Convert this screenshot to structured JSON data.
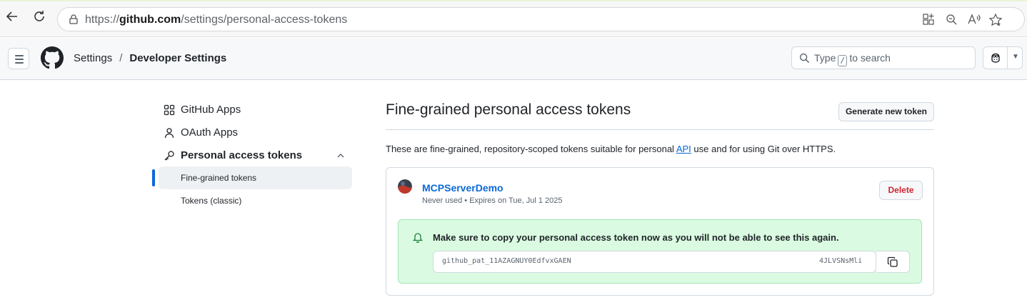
{
  "browser": {
    "url_scheme": "https://",
    "url_host": "github.com",
    "url_path": "/settings/personal-access-tokens",
    "icons": [
      "back-arrow-icon",
      "reload-icon",
      "site-info-icon",
      "app-available-icon",
      "zoom-icon",
      "read-aloud-icon",
      "favorite-star-icon"
    ]
  },
  "header": {
    "breadcrumb": {
      "settings": "Settings",
      "separator": "/",
      "current": "Developer Settings"
    },
    "search": {
      "prefix": "Type",
      "key": "/",
      "suffix": "to search"
    }
  },
  "sidebar": {
    "items": [
      {
        "label": "GitHub Apps",
        "icon": "apps-grid-icon"
      },
      {
        "label": "OAuth Apps",
        "icon": "person-icon"
      },
      {
        "label": "Personal access tokens",
        "icon": "key-icon",
        "expanded": true
      }
    ],
    "subitems": [
      {
        "label": "Fine-grained tokens",
        "active": true
      },
      {
        "label": "Tokens (classic)",
        "active": false
      }
    ]
  },
  "main": {
    "title": "Fine-grained personal access tokens",
    "generate_button": "Generate new token",
    "intro_before": "These are fine-grained, repository-scoped tokens suitable for personal ",
    "intro_link": "API",
    "intro_after": " use and for using Git over HTTPS.",
    "token": {
      "name": "MCPServerDemo",
      "meta": "Never used • Expires on Tue, Jul 1 2025",
      "delete_button": "Delete",
      "flash_message": "Make sure to copy your personal access token now as you will not be able to see this again.",
      "value_start": "github_pat_11AZAGNUY0EdfvxGAEN",
      "value_end": "4JLVSNsMli"
    }
  },
  "colors": {
    "link": "#0969da",
    "danger": "#d1242f",
    "flash_bg": "#dafbe1",
    "flash_border": "#a3e3b4",
    "active_marker": "#0969da"
  }
}
